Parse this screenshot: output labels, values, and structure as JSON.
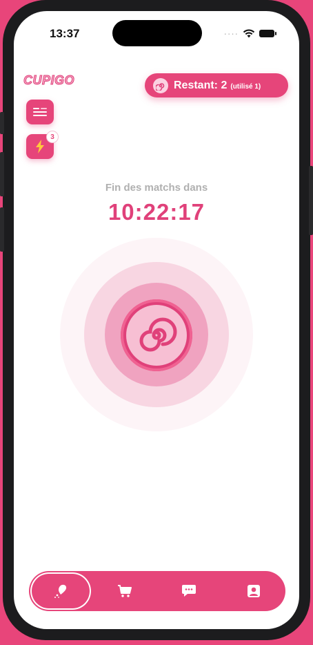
{
  "status_bar": {
    "time": "13:37"
  },
  "app": {
    "logo_text": "CUPIGO"
  },
  "header": {
    "remaining_main": "Restant: 2",
    "remaining_sub": "(utilisé 1)",
    "boost_badge": "3"
  },
  "timer": {
    "label": "Fin des matchs dans",
    "value": "10:22:17"
  },
  "nav": {
    "items": [
      {
        "name": "match",
        "icon": "match-icon",
        "active": true
      },
      {
        "name": "shop",
        "icon": "cart-icon"
      },
      {
        "name": "messages",
        "icon": "chat-icon"
      },
      {
        "name": "profile",
        "icon": "profile-icon"
      }
    ]
  },
  "colors": {
    "accent": "#e6457a",
    "background": "#e8457a",
    "timer": "#e0417a",
    "label_gray": "#b0b0b0"
  }
}
